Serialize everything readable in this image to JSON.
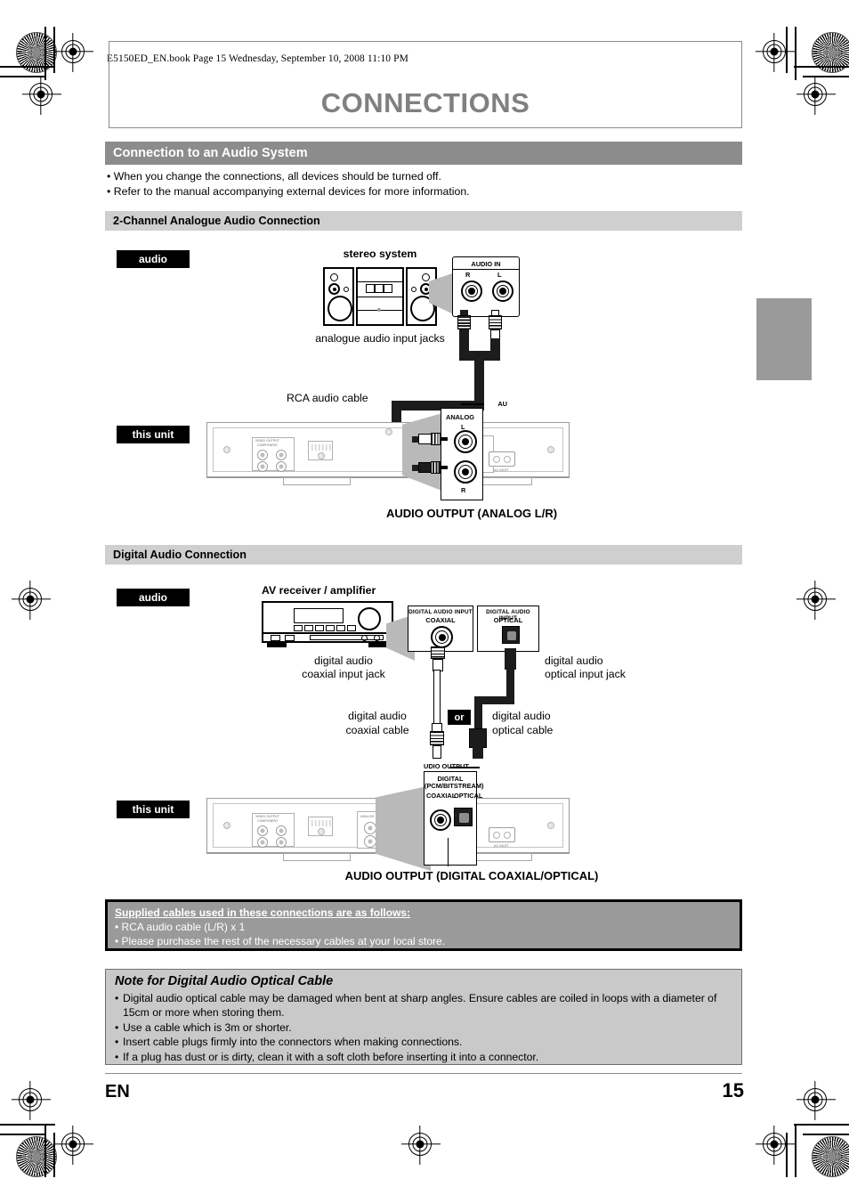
{
  "page": {
    "file_header": "E5150ED_EN.book  Page 15  Wednesday, September 10, 2008  11:10 PM",
    "chapter_title": "CONNECTIONS",
    "footer_lang": "EN",
    "footer_page": "15",
    "accent_gray": "#8c8c8c",
    "subbar_gray": "#cfcfcf"
  },
  "section": {
    "title": "Connection to an Audio System",
    "bullets": [
      "•  When you change the connections, all devices should be turned off.",
      "•  Refer to the manual accompanying external devices for more information."
    ]
  },
  "analogue": {
    "bar_title": "2-Channel Analogue Audio Connection",
    "badge_audio": "audio",
    "badge_this_unit": "this unit",
    "device_title": "stereo system",
    "device_jacks_label": "analogue audio input jacks",
    "cable_label": "RCA audio cable",
    "callout_in": {
      "title": "AUDIO IN",
      "right": "R",
      "left": "L"
    },
    "callout_out": {
      "title": "AU",
      "sub": "ANALOG",
      "left": "L",
      "right": "R"
    },
    "output_caption": "AUDIO OUTPUT (ANALOG L/R)"
  },
  "digital": {
    "bar_title": "Digital Audio Connection",
    "badge_audio": "audio",
    "badge_this_unit": "this unit",
    "device_title": "AV receiver / amplifier",
    "callout_coax": {
      "line1": "DIGITAL AUDIO INPUT",
      "line2": "COAXIAL"
    },
    "callout_opt": {
      "line1": "DIGITAL AUDIO INPUT",
      "line2": "OPTICAL"
    },
    "jack_label_coax": "digital audio\ncoaxial input jack",
    "jack_label_coax_1": "digital audio",
    "jack_label_coax_2": "coaxial input jack",
    "jack_label_opt_1": "digital audio",
    "jack_label_opt_2": "optical input jack",
    "cable_coax_1": "digital audio",
    "cable_coax_2": "coaxial cable",
    "cable_opt_1": "digital audio",
    "cable_opt_2": "optical cable",
    "or_badge": "or",
    "callout_out": {
      "title": "UDIO OUTPUT",
      "sub1": "DIGITAL",
      "sub2": "(PCM/BITSTREAM)",
      "coaxial": "COAXIAL",
      "optical": "OPTICAL"
    },
    "output_caption": "AUDIO OUTPUT (DIGITAL COAXIAL/OPTICAL)"
  },
  "supplied": {
    "heading": "Supplied cables used in these connections are as follows:",
    "items": [
      "•  RCA audio cable (L/R) x 1",
      "•  Please purchase the rest of the necessary cables at your local store."
    ]
  },
  "note_optical": {
    "heading": "Note for Digital Audio Optical Cable",
    "items": [
      "Digital audio optical cable may be damaged when bent at sharp angles. Ensure cables are coiled in loops with a diameter of 15cm or more when storing them.",
      "Use a cable which is 3m or shorter.",
      "Insert cable plugs firmly into the connectors when making connections.",
      "If a plug has dust or is dirty, clean it with a soft cloth before inserting it into a connector."
    ],
    "bullet": "•"
  },
  "rear_panel_labels": {
    "video_output": "VIDEO OUTPUT",
    "component": "COMPONENT",
    "audio_output": "AUDIO OUTPUT",
    "digital_out": "DIGITAL OUT",
    "analog": "ANALOG",
    "coaxial": "COAXIAL",
    "optical": "OPTICAL",
    "ac_inlet": "AC INLET"
  }
}
